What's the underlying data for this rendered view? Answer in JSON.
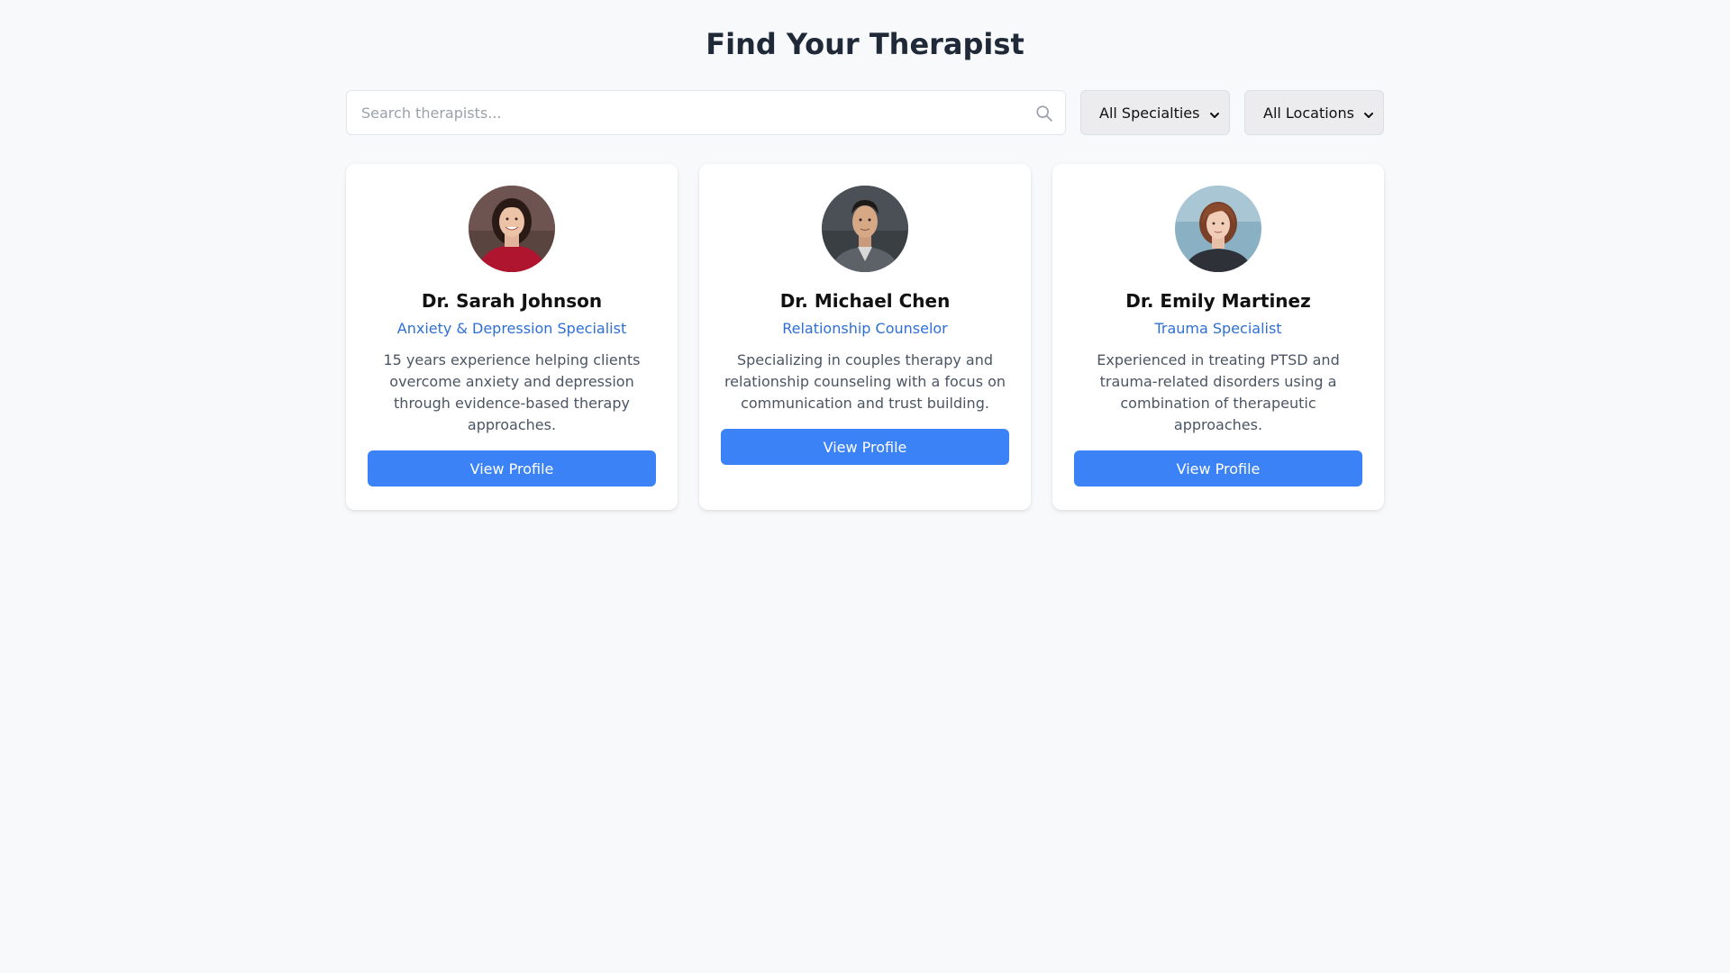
{
  "page": {
    "title": "Find Your Therapist"
  },
  "search": {
    "placeholder": "Search therapists...",
    "value": ""
  },
  "filters": {
    "specialty_selected": "All Specialties",
    "location_selected": "All Locations"
  },
  "colors": {
    "accent": "#3b82f6",
    "specialty_text": "#2f6fd4",
    "background": "#f8f9fb"
  },
  "therapists": [
    {
      "name": "Dr. Sarah Johnson",
      "specialty": "Anxiety & Depression Specialist",
      "description": "15 years experience helping clients overcome anxiety and depression through evidence-based therapy approaches.",
      "button_label": "View Profile"
    },
    {
      "name": "Dr. Michael Chen",
      "specialty": "Relationship Counselor",
      "description": "Specializing in couples therapy and relationship counseling with a focus on communication and trust building.",
      "button_label": "View Profile"
    },
    {
      "name": "Dr. Emily Martinez",
      "specialty": "Trauma Specialist",
      "description": "Experienced in treating PTSD and trauma-related disorders using a combination of therapeutic approaches.",
      "button_label": "View Profile"
    }
  ]
}
